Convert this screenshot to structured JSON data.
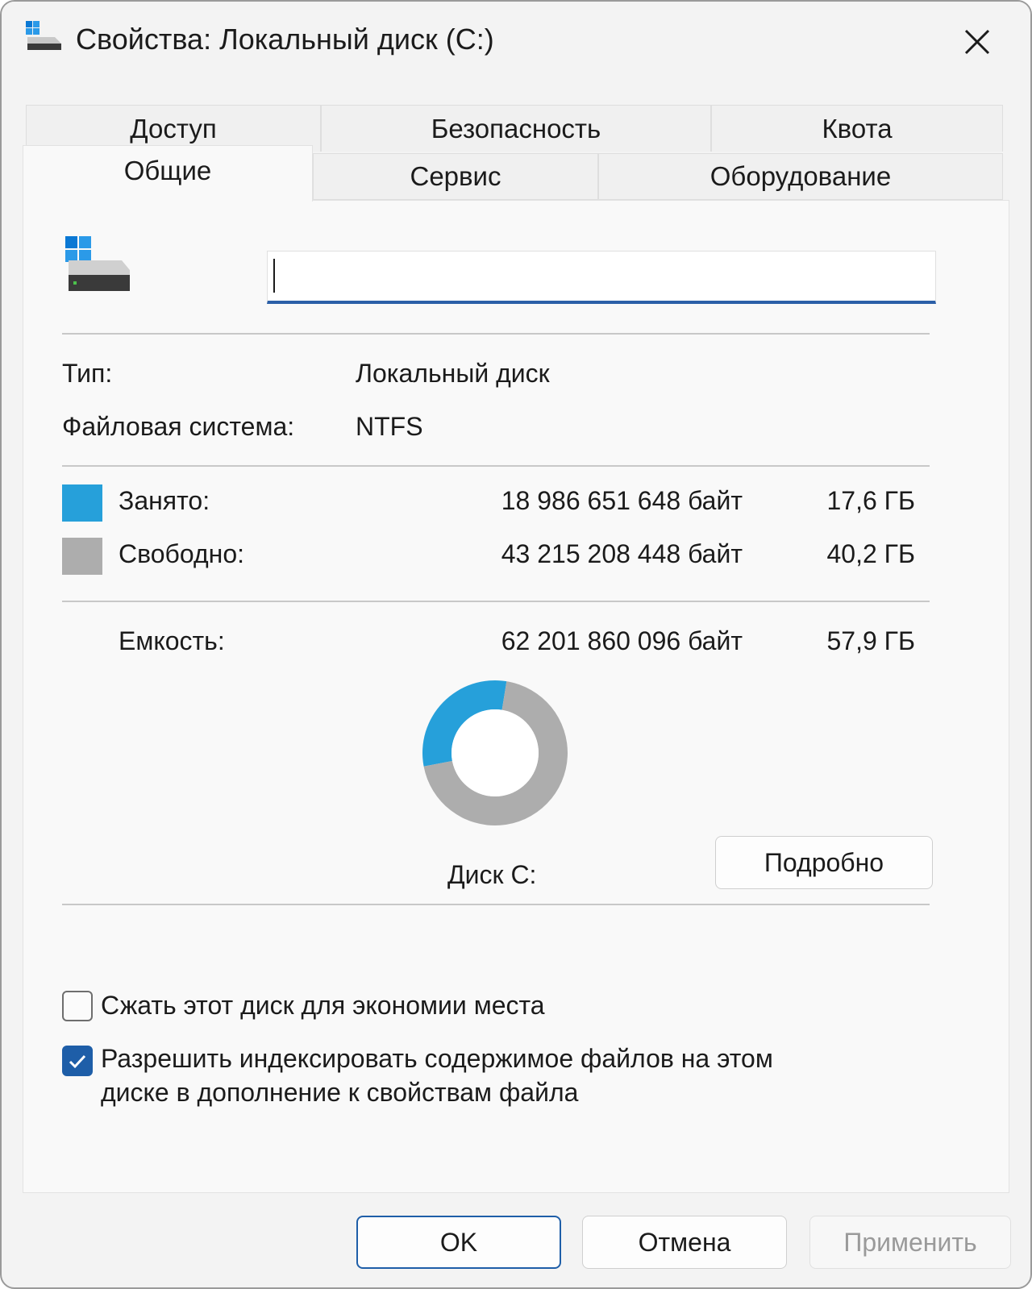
{
  "window": {
    "title": "Свойства: Локальный диск (C:)",
    "accent_color": "#1e5ea8"
  },
  "tabs_row1": [
    {
      "label": "Доступ"
    },
    {
      "label": "Безопасность"
    },
    {
      "label": "Квота"
    }
  ],
  "tabs_row2": [
    {
      "label": "Общие",
      "active": true
    },
    {
      "label": "Сервис"
    },
    {
      "label": "Оборудование"
    }
  ],
  "general": {
    "name_value": "",
    "type_label": "Тип:",
    "type_value": "Локальный диск",
    "fs_label": "Файловая система:",
    "fs_value": "NTFS",
    "used": {
      "label": "Занято:",
      "bytes": "18 986 651 648 байт",
      "size": "17,6 ГБ",
      "color": "#26a0da"
    },
    "free": {
      "label": "Свободно:",
      "bytes": "43 215 208 448 байт",
      "size": "40,2 ГБ",
      "color": "#adadad"
    },
    "capacity": {
      "label": "Емкость:",
      "bytes": "62 201 860 096 байт",
      "size": "57,9 ГБ"
    },
    "disk_label": "Диск C:",
    "details_button": "Подробно"
  },
  "chart_data": {
    "type": "pie",
    "categories": [
      "Занято",
      "Свободно"
    ],
    "values": [
      18986651648,
      43215208448
    ],
    "colors": [
      "#26a0da",
      "#adadad"
    ],
    "donut": true
  },
  "options": {
    "compress": {
      "label": "Сжать этот диск для экономии места",
      "checked": false
    },
    "index": {
      "label_line1": "Разрешить индексировать содержимое файлов на этом",
      "label_line2": "диске в дополнение к свойствам файла",
      "checked": true
    }
  },
  "footer": {
    "ok": "OK",
    "cancel": "Отмена",
    "apply": "Применить"
  }
}
